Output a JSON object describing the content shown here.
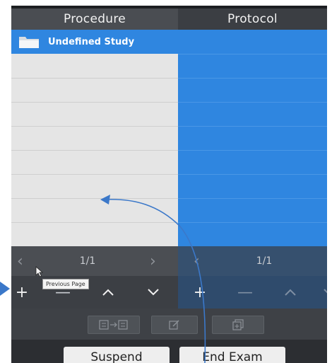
{
  "headers": {
    "procedure": "Procedure",
    "protocol": "Protocol"
  },
  "procedure": {
    "study_label": "Undefined Study",
    "pager": "1/1"
  },
  "protocol": {
    "pager": "1/1"
  },
  "tooltip": "Previous Page",
  "buttons": {
    "suspend": "Suspend",
    "end_exam": "End Exam"
  },
  "icons": {
    "folder": "folder-icon",
    "prev": "chevron-left-icon",
    "next": "chevron-right-icon",
    "add": "plus-icon",
    "remove": "minus-icon",
    "up": "chevron-up-icon",
    "down": "chevron-down-icon",
    "transfer": "transfer-icon",
    "edit": "edit-icon",
    "append": "append-icon",
    "cursor": "mouse-cursor-icon"
  },
  "colors": {
    "selection_blue": "#2f86e0",
    "annotation_blue": "#3b78c9"
  }
}
